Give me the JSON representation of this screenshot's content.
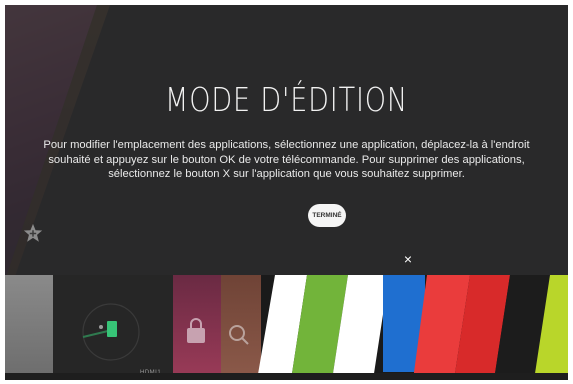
{
  "edit_mode": {
    "title": "MODE D'ÉDITION",
    "description": "Pour modifier l'emplacement des applications, sélectionnez une application, déplacez-la à l'endroit souhaité et appuyez sur le bouton OK de votre télécommande. Pour supprimer des applications, sélectionnez le bouton X sur l'application que vous souhaitez supprimer.",
    "done_label": "TERMINÉ"
  },
  "launcher": {
    "delete_mark": "×",
    "input_label": "HDMI1",
    "tiles": [
      {
        "name": "tile-gray",
        "color": "#7d7d7d"
      },
      {
        "name": "tile-hdmi",
        "color": "#2a2a2a"
      },
      {
        "name": "tile-store",
        "color": "#8a3050"
      },
      {
        "name": "tile-search",
        "color": "#7a4a3a"
      },
      {
        "name": "tile-white-1",
        "color": "#ffffff"
      },
      {
        "name": "tile-green",
        "color": "#6fb23a"
      },
      {
        "name": "tile-white-2",
        "color": "#ffffff"
      },
      {
        "name": "tile-blue-selected",
        "color": "#1f6fd0"
      },
      {
        "name": "tile-red-1",
        "color": "#e83a3a"
      },
      {
        "name": "tile-red-2",
        "color": "#de2d2d"
      },
      {
        "name": "tile-black",
        "color": "#1e1e1e"
      },
      {
        "name": "tile-lime",
        "color": "#b5d42a"
      }
    ]
  }
}
